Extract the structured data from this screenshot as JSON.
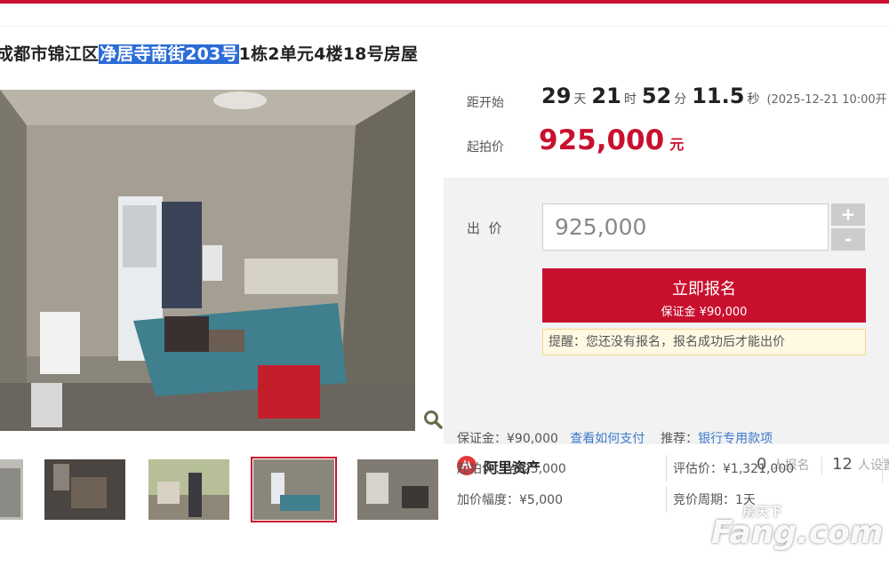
{
  "page": {
    "title_prefix": "成都市锦江区",
    "title_highlight": "净居寺南街203号",
    "title_suffix": "1栋2单元4楼18号房屋"
  },
  "auction": {
    "countdown_label": "距开始",
    "days": "29",
    "days_unit": "天",
    "hours": "21",
    "hours_unit": "时",
    "minutes": "52",
    "minutes_unit": "分",
    "seconds": "11.5",
    "seconds_unit": "秒",
    "start_date": "(2025-12-21 10:00开",
    "start_price_label": "起拍价",
    "start_price": "925,000",
    "currency": "元",
    "bid_label": "出  价",
    "bid_value": "925,000",
    "plus": "+",
    "minus": "-",
    "signup_label": "立即报名",
    "deposit_label": "保证金 ¥90,000",
    "reminder": "提醒：您还没有报名，报名成功后才能出价"
  },
  "platform": {
    "name": "阿里资产",
    "signups_num": "0",
    "signups_unit": "人报名",
    "reminders_num": "12",
    "reminders_unit": "人设置"
  },
  "details": {
    "deposit": "保证金：¥90,000",
    "how_to_pay": "查看如何支付",
    "recommend_label": "推荐：",
    "bank_loan": "银行专用款项",
    "start_price": "起拍价：¥925,000",
    "appraisal": "评估价：¥1,321,000",
    "increment": "加价幅度：¥5,000",
    "period": "竞价周期：1天"
  },
  "watermark": {
    "text_small": "房天下",
    "text_big": "Fang.com"
  },
  "colors": {
    "accent": "#c8102e",
    "link": "#3d7acc"
  },
  "icons": [
    "zoom-icon",
    "ali-assets-logo-icon"
  ]
}
